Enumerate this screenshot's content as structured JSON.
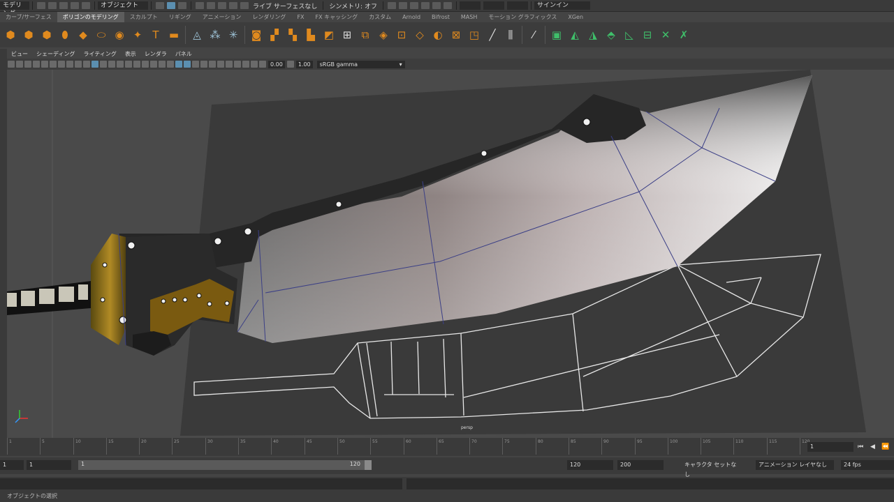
{
  "status_line": {
    "menu_set": "モデリング",
    "selection_mode": "オブジェクト",
    "symmetry": "シンメトリ: オフ",
    "live_surface": "ライブ サーフェスなし",
    "sign_in": "サインイン"
  },
  "shelf_tabs": [
    "カーブ/サーフェス",
    "ポリゴンのモデリング",
    "スカルプト",
    "リギング",
    "アニメーション",
    "レンダリング",
    "FX",
    "FX キャッシング",
    "カスタム",
    "Arnold",
    "Bifrost",
    "MASH",
    "モーション グラフィックス",
    "XGen"
  ],
  "shelf_active_index": 1,
  "shelf_icons": [
    {
      "name": "sphere-icon",
      "glyph": "⬢",
      "color": "#e08a1e"
    },
    {
      "name": "cube-icon",
      "glyph": "⬢",
      "color": "#e08a1e"
    },
    {
      "name": "cylinder-icon",
      "glyph": "⬢",
      "color": "#e08a1e"
    },
    {
      "name": "cone-icon",
      "glyph": "⬮",
      "color": "#e08a1e"
    },
    {
      "name": "plane-icon",
      "glyph": "◆",
      "color": "#e08a1e"
    },
    {
      "name": "torus-icon",
      "glyph": "⬭",
      "color": "#e08a1e"
    },
    {
      "name": "platonic-icon",
      "glyph": "◉",
      "color": "#e08a1e"
    },
    {
      "name": "super-shape-icon",
      "glyph": "✦",
      "color": "#e08a1e"
    },
    {
      "name": "type-icon",
      "glyph": "T",
      "color": "#e08a1e"
    },
    {
      "name": "svg-icon",
      "glyph": "▬",
      "color": "#e08a1e"
    },
    {
      "name": "combine-icon",
      "glyph": "◬",
      "color": "#9fc4d8"
    },
    {
      "name": "separate-icon",
      "glyph": "⁂",
      "color": "#9fc4d8"
    },
    {
      "name": "smooth-icon",
      "glyph": "✳",
      "color": "#9fc4d8"
    },
    {
      "name": "boolean-icon",
      "glyph": "◙",
      "color": "#e08a1e"
    },
    {
      "name": "mirror-icon",
      "glyph": "▞",
      "color": "#e08a1e"
    },
    {
      "name": "extrude-icon",
      "glyph": "▚",
      "color": "#e08a1e"
    },
    {
      "name": "bridge-icon",
      "glyph": "▙",
      "color": "#e08a1e"
    },
    {
      "name": "bevel-icon",
      "glyph": "◩",
      "color": "#e08a1e"
    },
    {
      "name": "fill-hole-icon",
      "glyph": "⊞",
      "color": "#dddddd"
    },
    {
      "name": "multi-cut-icon",
      "glyph": "⧉",
      "color": "#e08a1e"
    },
    {
      "name": "target-weld-icon",
      "glyph": "◈",
      "color": "#e08a1e"
    },
    {
      "name": "connect-icon",
      "glyph": "⊡",
      "color": "#e08a1e"
    },
    {
      "name": "quad-draw-icon",
      "glyph": "◇",
      "color": "#e08a1e"
    },
    {
      "name": "insert-loop-icon",
      "glyph": "◐",
      "color": "#e08a1e"
    },
    {
      "name": "uv-editor-icon",
      "glyph": "⊠",
      "color": "#e08a1e"
    },
    {
      "name": "planar-map-icon",
      "glyph": "◳",
      "color": "#e08a1e"
    },
    {
      "name": "cut-uv-icon",
      "glyph": "╱",
      "color": "#dddddd"
    },
    {
      "name": "sew-uv-icon",
      "glyph": "⫼",
      "color": "#dddddd"
    },
    {
      "name": "unfold-icon",
      "glyph": "⁄",
      "color": "#dddddd"
    },
    {
      "name": "normals-icon",
      "glyph": "▣",
      "color": "#3fbf6a"
    },
    {
      "name": "soften-edge-icon",
      "glyph": "◭",
      "color": "#3fbf6a"
    },
    {
      "name": "harden-edge-icon",
      "glyph": "◮",
      "color": "#3fbf6a"
    },
    {
      "name": "cleanup-icon",
      "glyph": "⬘",
      "color": "#3fbf6a"
    },
    {
      "name": "triangulate-icon",
      "glyph": "◺",
      "color": "#3fbf6a"
    },
    {
      "name": "quadrangulate-icon",
      "glyph": "⊟",
      "color": "#3fbf6a"
    },
    {
      "name": "reduce-icon",
      "glyph": "✕",
      "color": "#3fbf6a"
    },
    {
      "name": "retopo-icon",
      "glyph": "✗",
      "color": "#3fbf6a"
    }
  ],
  "panel_menu": [
    "ビュー",
    "シェーディング",
    "ライティング",
    "表示",
    "レンダラ",
    "パネル"
  ],
  "panel_toolbar": {
    "exposure": "0.00",
    "gamma": "1.00",
    "color_space": "sRGB gamma"
  },
  "viewport": {
    "camera_label": "persp"
  },
  "timeline": {
    "ticks": [
      "1",
      "5",
      "10",
      "15",
      "20",
      "25",
      "30",
      "35",
      "40",
      "45",
      "50",
      "55",
      "60",
      "65",
      "70",
      "75",
      "80",
      "85",
      "90",
      "95",
      "100",
      "105",
      "110",
      "115",
      "120"
    ],
    "current_frame": "1"
  },
  "range": {
    "start": "1",
    "slider_start": "1",
    "slider_end": "120",
    "end": "120",
    "anim_end": "200",
    "character_set": "キャラクタ セットなし",
    "anim_layer": "アニメーション レイヤなし",
    "fps": "24 fps"
  },
  "help_line": "オブジェクトの選択",
  "colors": {
    "accent": "#5b8fb0",
    "background": "#444444",
    "panel": "#3a3a3a"
  }
}
